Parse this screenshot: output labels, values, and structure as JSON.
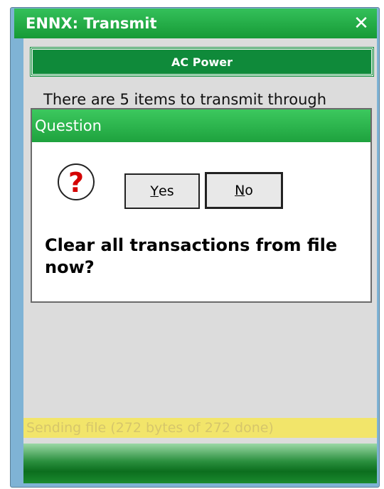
{
  "window": {
    "title": "ENNX: Transmit",
    "close_glyph": "✕"
  },
  "banner": {
    "label": "AC Power"
  },
  "info_text": "There are 5 items to transmit through",
  "dialog": {
    "title": "Question",
    "icon": "question-icon",
    "yes": {
      "mnemonic": "Y",
      "rest": "es"
    },
    "no": {
      "mnemonic": "N",
      "rest": "o"
    },
    "message": "Clear all transactions from file now?"
  },
  "status": {
    "text": "Sending file (272 bytes of 272 done)"
  },
  "colors": {
    "title_green": "#1ea23e",
    "banner_green": "#0f8a3a",
    "status_yellow": "#f2e56a",
    "question_red": "#d40000"
  }
}
